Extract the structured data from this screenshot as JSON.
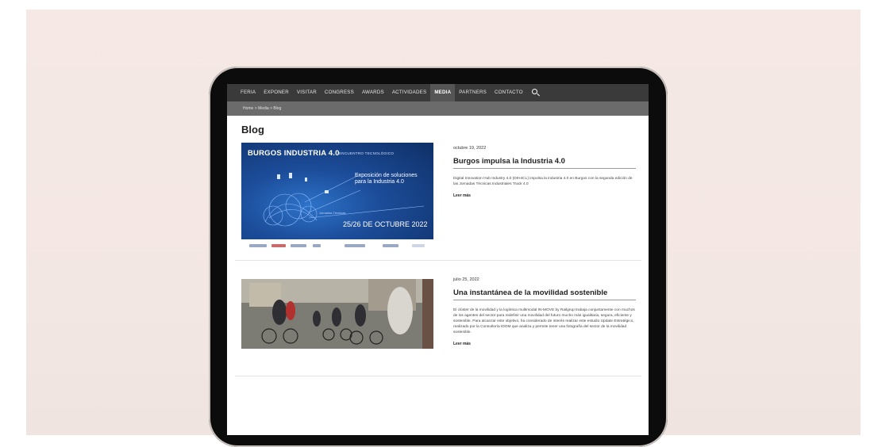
{
  "nav": {
    "items": [
      "FERIA",
      "EXPONER",
      "VISITAR",
      "CONGRESS",
      "AWARDS",
      "ACTIVIDADES",
      "MEDIA",
      "PARTNERS",
      "CONTACTO"
    ],
    "active": "MEDIA",
    "search_icon": "search-icon"
  },
  "breadcrumb": "Home > Media > Blog",
  "page_title": "Blog",
  "posts": [
    {
      "date": "octubre 19, 2022",
      "title": "Burgos impulsa la Industria 4.0",
      "excerpt": "Digital Innovation Hub Industry 4.0 (DIH4CL) impulsa la industria 4.0 en Burgos con la segunda edición de las Jornadas Técnicas Industriales Track 4.0",
      "read_more": "Leer más",
      "image": {
        "heading": "BURGOS INDUSTRIA 4.0",
        "subheading": "ENCUENTRO TECNOLÓGICO",
        "center_text": "Exposición de soluciones para la Industria 4.0",
        "tag": "Jornadas Técnicas",
        "dates": "25/26 DE OCTUBRE 2022"
      }
    },
    {
      "date": "julio 25, 2022",
      "title": "Una instantánea de la movilidad sostenible",
      "excerpt": "El clúster de la movilidad y la logística multimodal IN-MOVE by Railgrup trabaja conjuntamente con muchos de los agentes del sector para redefinir una movilidad del futuro mucho más igualitaria, segura, eficiente y sostenible. Para alcanzar este objetivo, ha considerado de interés realizar este estudio Update Estratégico, realizado por la Consultoría IDOM que analiza y permite tener una fotografía del sector de la movilidad sostenible.",
      "read_more": "Leer más"
    }
  ],
  "colors": {
    "nav_bg": "#3a3a3a",
    "breadcrumb_bg": "#6b6b6b",
    "backdrop": "#f5e8e5"
  }
}
